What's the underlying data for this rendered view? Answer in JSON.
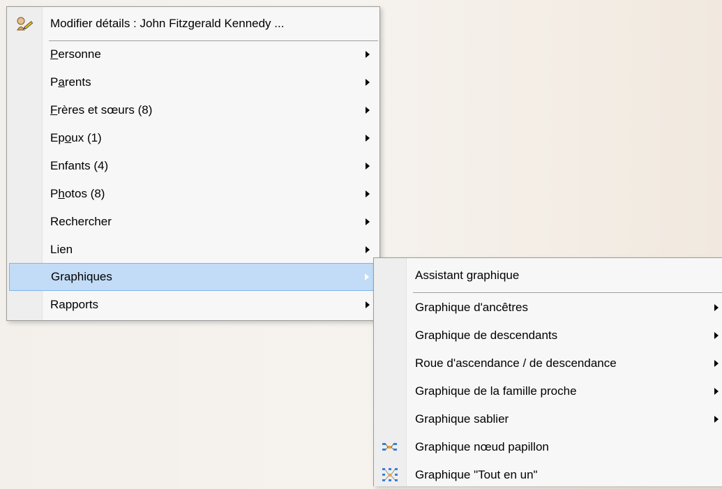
{
  "main_menu": {
    "header": "Modifier détails : John Fitzgerald Kennedy ...",
    "header_icon": "person-edit-icon",
    "items": [
      {
        "pre": "",
        "u": "P",
        "post": "ersonne"
      },
      {
        "pre": "P",
        "u": "a",
        "post": "rents"
      },
      {
        "pre": "",
        "u": "F",
        "post": "rères et sœurs (8)"
      },
      {
        "pre": "Ep",
        "u": "o",
        "post": "ux (1)"
      },
      {
        "pre": "Enfants (4)",
        "u": "",
        "post": ""
      },
      {
        "pre": "P",
        "u": "h",
        "post": "otos (8)"
      },
      {
        "pre": "Rechercher",
        "u": "",
        "post": ""
      },
      {
        "pre": "Lien",
        "u": "",
        "post": ""
      },
      {
        "pre": "Graphiques",
        "u": "",
        "post": ""
      },
      {
        "pre": "Rapports",
        "u": "",
        "post": ""
      }
    ],
    "highlighted": "Graphiques"
  },
  "sub_menu": {
    "header": "Assistant graphique",
    "items": [
      {
        "label": "Graphique d'ancêtres",
        "has_submenu": true
      },
      {
        "label": "Graphique de descendants",
        "has_submenu": true
      },
      {
        "label": "Roue d'ascendance / de descendance",
        "has_submenu": true
      },
      {
        "label": "Graphique de la famille proche",
        "has_submenu": true
      },
      {
        "label": "Graphique sablier",
        "has_submenu": true
      },
      {
        "label": "Graphique nœud papillon",
        "has_submenu": false,
        "icon": "bowtie-chart-icon"
      },
      {
        "label": "Graphique \"Tout en un\"",
        "has_submenu": false,
        "icon": "all-in-one-chart-icon"
      }
    ]
  },
  "colors": {
    "highlight_bg": "#c2dcf7",
    "highlight_border": "#7eb4ea",
    "menu_bg": "#f7f7f7",
    "gutter_bg": "#eeeeee"
  }
}
